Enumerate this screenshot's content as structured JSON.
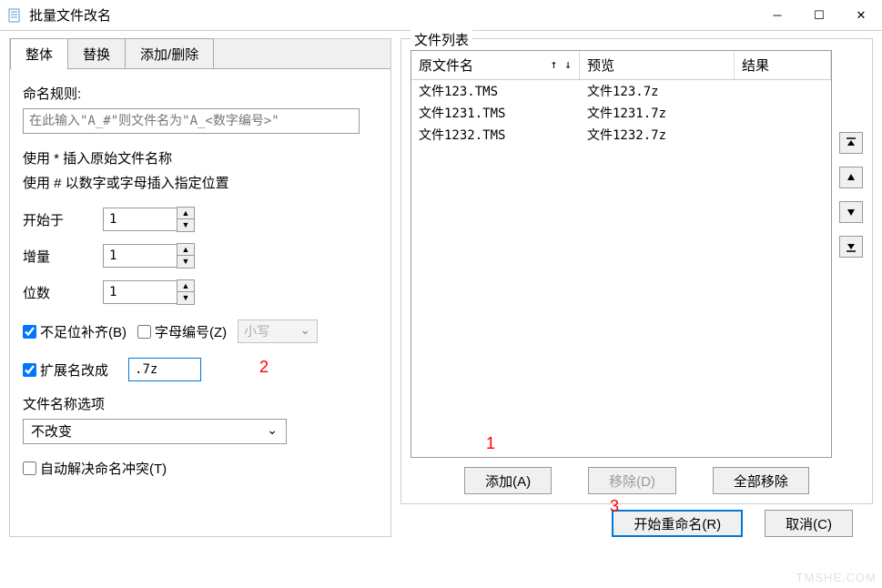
{
  "window": {
    "title": "批量文件改名"
  },
  "tabs": {
    "whole": "整体",
    "replace": "替换",
    "add_delete": "添加/删除"
  },
  "rule": {
    "label": "命名规则:",
    "placeholder": "在此输入\"A_#\"则文件名为\"A_<数字编号>\"",
    "hint1": "使用 * 插入原始文件名称",
    "hint2": "使用 # 以数字或字母插入指定位置"
  },
  "start": {
    "label": "开始于",
    "value": "1"
  },
  "step": {
    "label": "增量",
    "value": "1"
  },
  "digits": {
    "label": "位数",
    "value": "1"
  },
  "pad": {
    "label": "不足位补齐(B)",
    "checked": true
  },
  "alpha": {
    "label": "字母编号(Z)",
    "checked": false
  },
  "case_select": {
    "value": "小写"
  },
  "ext": {
    "label": "扩展名改成",
    "checked": true,
    "value": ".7z"
  },
  "filename_opt": {
    "label": "文件名称选项",
    "value": "不改变"
  },
  "autofix": {
    "label": "自动解决命名冲突(T)",
    "checked": false
  },
  "filelist": {
    "legend": "文件列表",
    "col_orig": "原文件名",
    "col_prev": "预览",
    "col_res": "结果",
    "rows": [
      {
        "orig": "文件123.TMS",
        "prev": "文件123.7z"
      },
      {
        "orig": "文件1231.TMS",
        "prev": "文件1231.7z"
      },
      {
        "orig": "文件1232.TMS",
        "prev": "文件1232.7z"
      }
    ]
  },
  "buttons": {
    "add": "添加(A)",
    "remove": "移除(D)",
    "remove_all": "全部移除",
    "start_rename": "开始重命名(R)",
    "cancel": "取消(C)"
  },
  "annotations": {
    "a1": "1",
    "a2": "2",
    "a3": "3"
  },
  "watermark": "TMSHE.COM"
}
